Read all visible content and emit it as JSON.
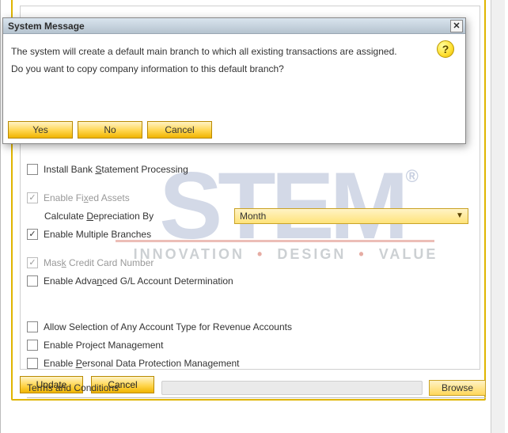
{
  "dialog": {
    "title": "System Message",
    "text": "The system will create a default main branch to which all existing transactions are assigned. Do you want to copy company information to this default branch?",
    "icon_name": "help-icon",
    "buttons": {
      "yes": "Yes",
      "no": "No",
      "cancel": "Cancel"
    }
  },
  "settings": {
    "items": [
      {
        "label": "Install Bank Statement Processing",
        "underline": "S",
        "checked": false,
        "disabled": false
      },
      {
        "label": "Enable Fixed Assets",
        "underline": "x",
        "checked": true,
        "disabled": true,
        "sub": {
          "label": "Calculate Depreciation By",
          "underline": "D",
          "combo_value": "Month"
        }
      },
      {
        "label": "Enable Multiple Branches",
        "underline": "",
        "checked": true,
        "disabled": false
      },
      {
        "label": "Mask Credit Card Number",
        "underline": "k",
        "checked": true,
        "disabled": true
      },
      {
        "label": "Enable Advanced G/L Account Determination",
        "underline": "n",
        "checked": false,
        "disabled": false
      },
      {
        "label": "Allow Selection of Any Account Type for Revenue Accounts",
        "underline": "",
        "checked": false,
        "disabled": false
      },
      {
        "label": "Enable Project Management",
        "underline": "j",
        "checked": false,
        "disabled": false
      },
      {
        "label": "Enable Personal Data Protection Management",
        "underline": "P",
        "checked": false,
        "disabled": false
      }
    ],
    "terms_label": "Terms and Conditions",
    "terms_value": "",
    "browse": "Browse",
    "footer": {
      "update": "Update",
      "cancel": "Cancel"
    }
  },
  "watermark": {
    "brand": "STEM",
    "registered": "®",
    "tagline_1": "INNOVATION",
    "tagline_2": "DESIGN",
    "tagline_3": "VALUE"
  }
}
